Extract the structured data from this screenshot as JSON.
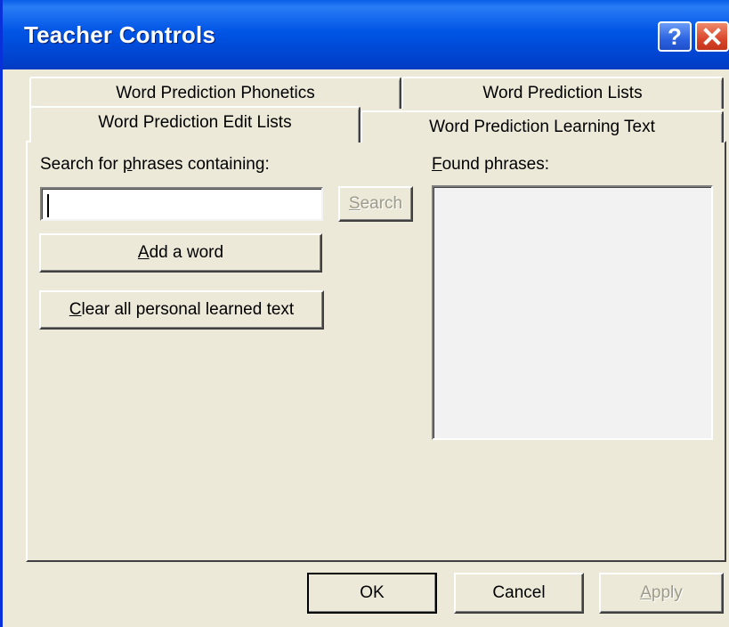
{
  "window": {
    "title": "Teacher Controls"
  },
  "titlebar": {
    "help_glyph": "?",
    "close_glyph": "x"
  },
  "tabs": {
    "row_back": [
      {
        "label": "Word Prediction Phonetics"
      },
      {
        "label": "Word Prediction Lists"
      }
    ],
    "row_front": [
      {
        "label": "Word Prediction Edit Lists",
        "selected": true
      },
      {
        "label": "Word Prediction Learning Text"
      }
    ]
  },
  "edit_lists": {
    "search_label": {
      "before": "Search for ",
      "mnemonic": "p",
      "after": "hrases containing:"
    },
    "search_input": {
      "value": ""
    },
    "search_button": {
      "mnemonic": "S",
      "after": "earch",
      "enabled": false
    },
    "add_word_button": {
      "mnemonic": "A",
      "after": "dd a word"
    },
    "clear_button": {
      "mnemonic": "C",
      "after": "lear all personal learned text"
    },
    "found_label": {
      "mnemonic": "F",
      "after": "ound phrases:"
    },
    "found_list": {
      "items": []
    }
  },
  "footer": {
    "ok_label": "OK",
    "cancel_label": "Cancel",
    "apply": {
      "mnemonic": "A",
      "after": "pply",
      "enabled": false
    }
  }
}
